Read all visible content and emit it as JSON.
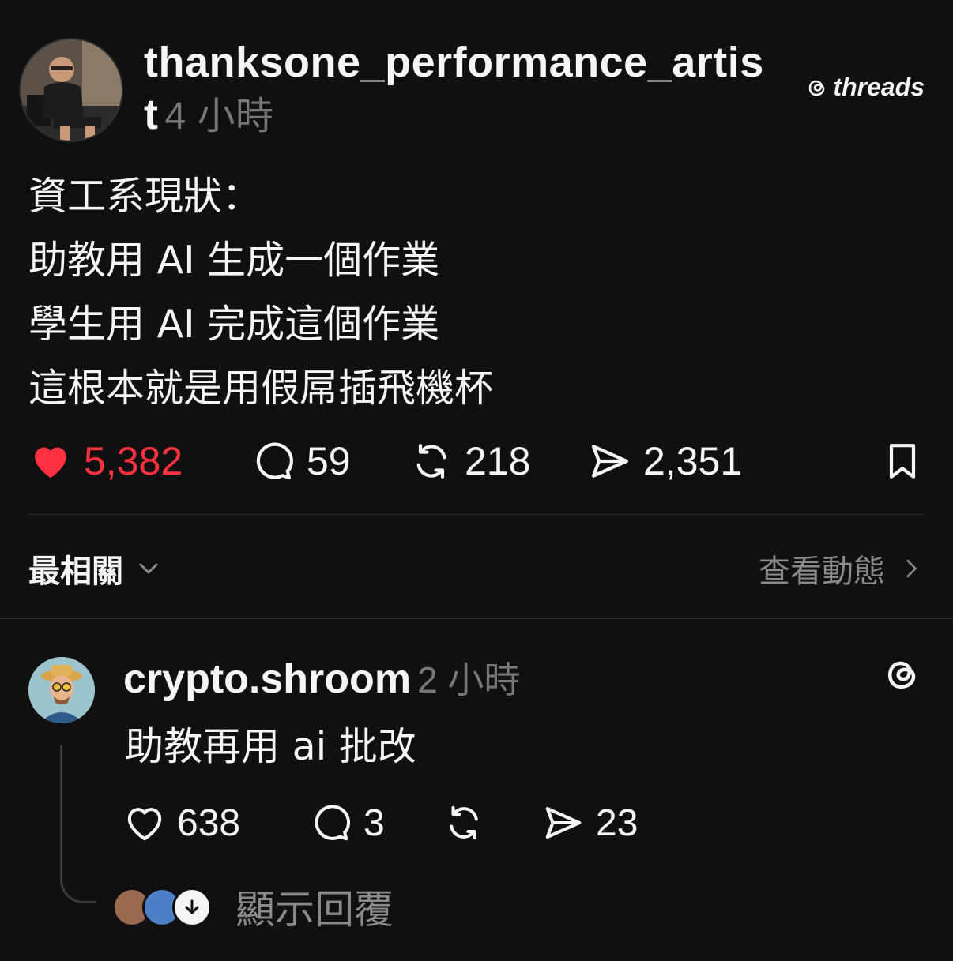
{
  "post": {
    "username": "thanksone_performance_artist",
    "timestamp": "4 小時",
    "brand": "threads",
    "lines": [
      "資工系現狀：",
      "助教用 AI 生成一個作業",
      "學生用 AI 完成這個作業",
      "這根本就是用假屌插飛機杯"
    ],
    "likes": "5,382",
    "replies": "59",
    "reposts": "218",
    "shares": "2,351",
    "liked": true,
    "like_color": "#ff3040"
  },
  "sort_bar": {
    "sort_label": "最相關",
    "activity_label": "查看動態"
  },
  "reply": {
    "username": "crypto.shroom",
    "timestamp": "2 小時",
    "text": "助教再用 ai 批改",
    "likes": "638",
    "replies": "3",
    "shares": "23",
    "show_replies_label": "顯示回覆"
  },
  "icons": {
    "like": "heart-icon",
    "reply": "comment-bubble-icon",
    "repost": "repost-arrows-icon",
    "share": "send-icon",
    "save": "bookmark-icon",
    "brand": "threads-logo-icon"
  }
}
